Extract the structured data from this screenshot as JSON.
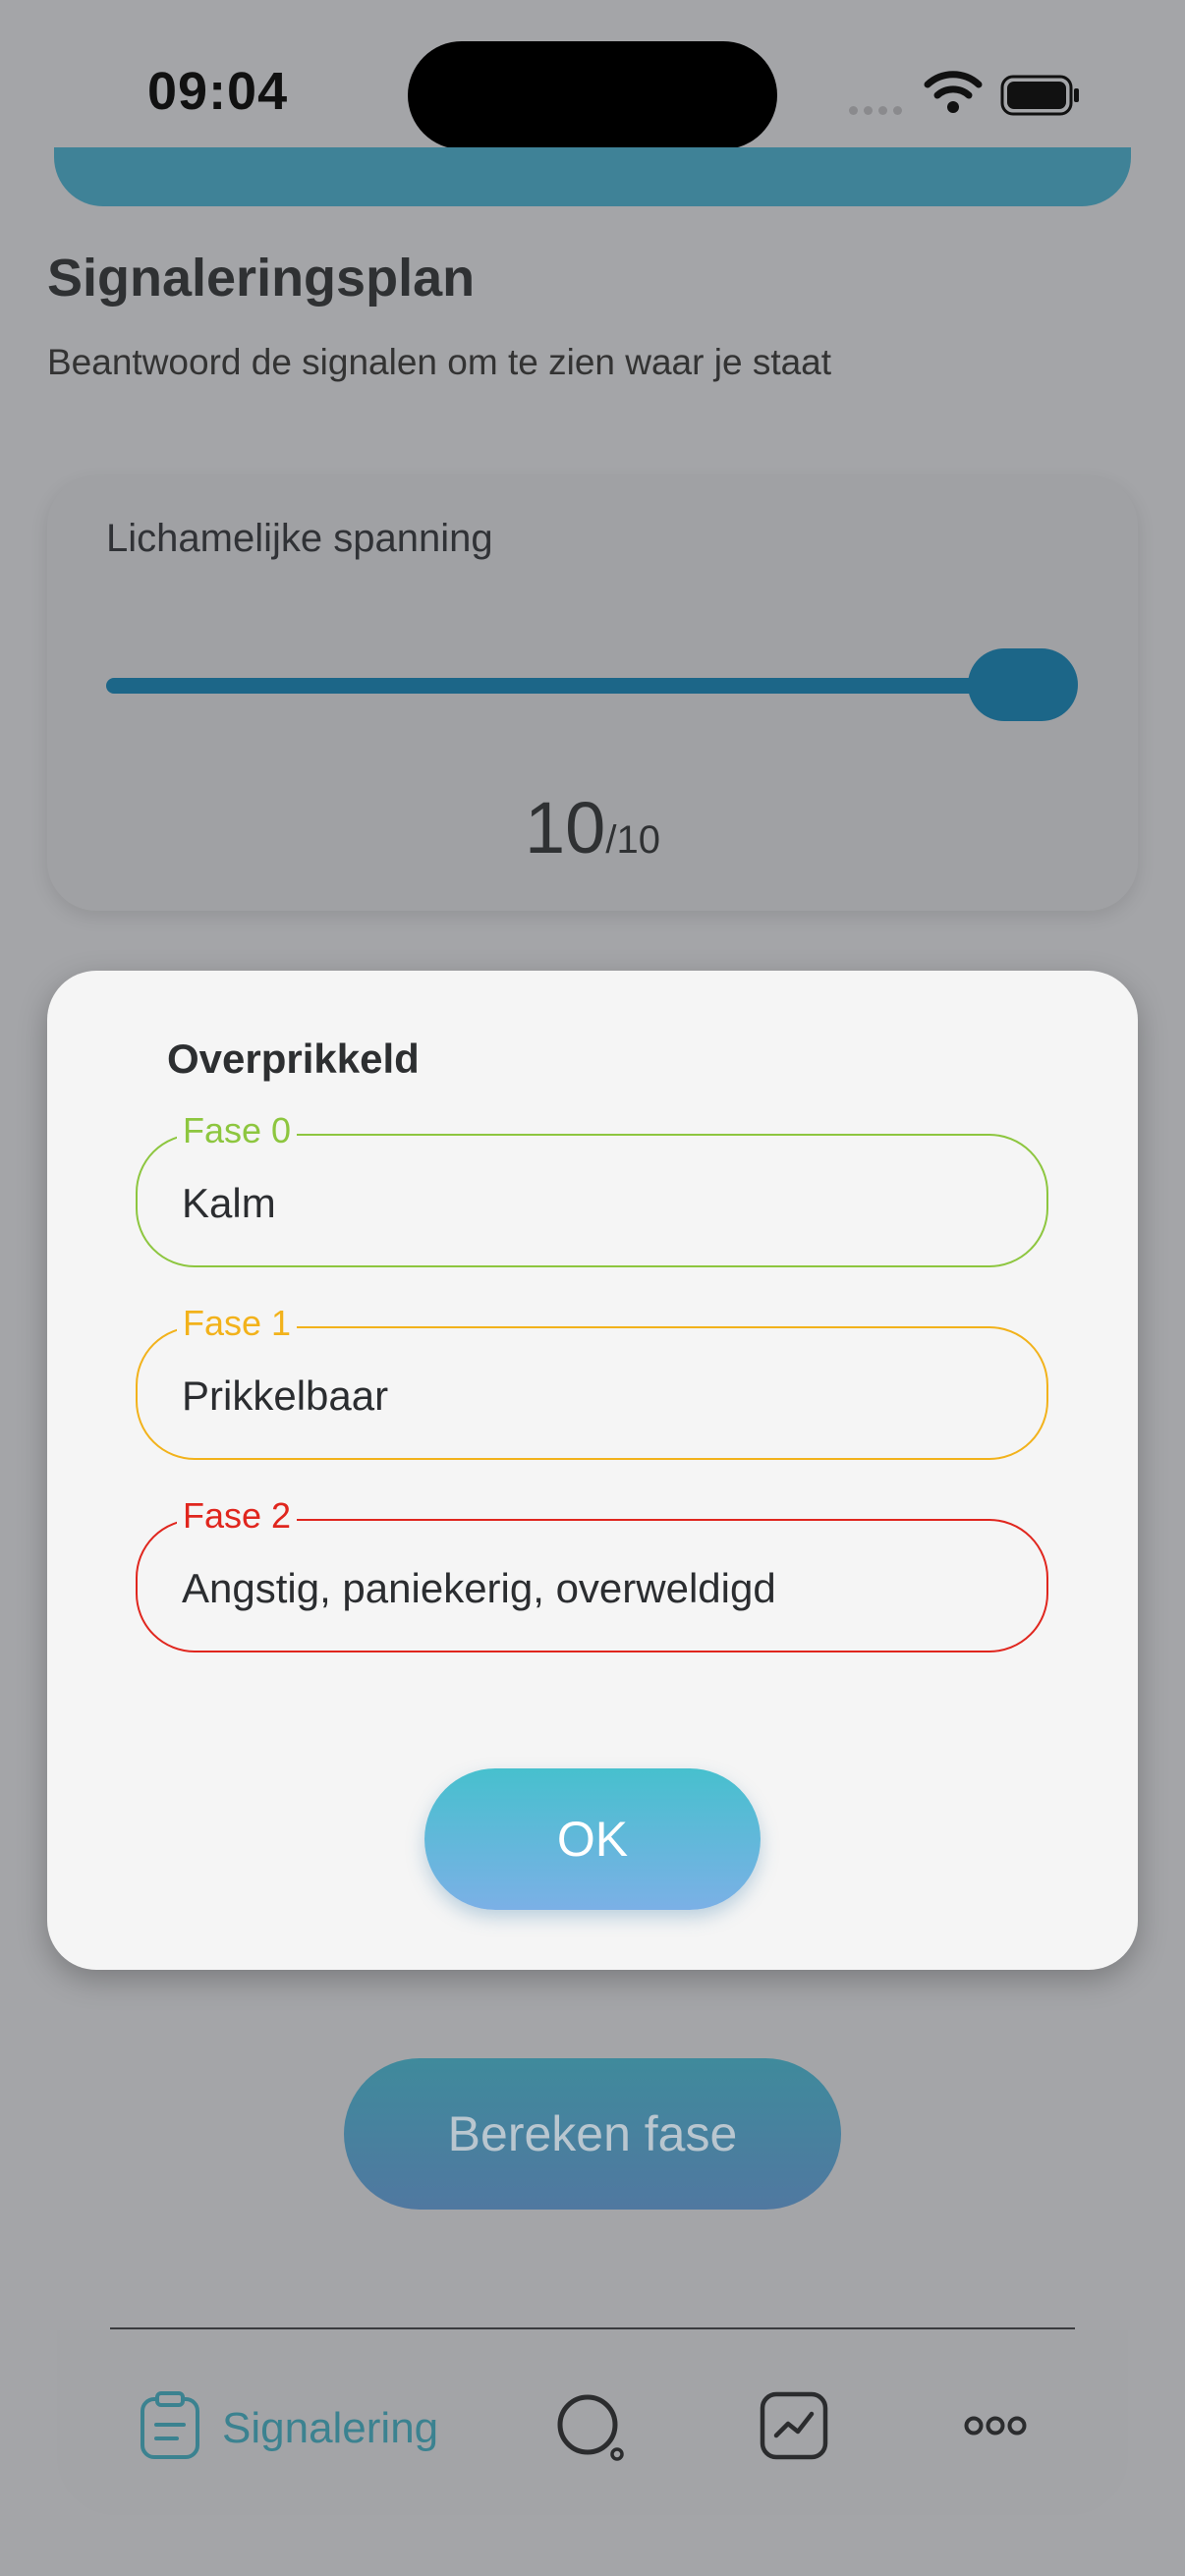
{
  "status_bar": {
    "time": "09:04"
  },
  "page": {
    "title": "Signaleringsplan",
    "subtitle": "Beantwoord de signalen om te zien waar je staat"
  },
  "signal_card": {
    "title": "Lichamelijke spanning",
    "value": "10",
    "max": "/10",
    "slider_level": 1.0
  },
  "dialog": {
    "title": "Overprikkeld",
    "phases": [
      {
        "label": "Fase 0",
        "text": "Kalm",
        "color": "#8dc63f"
      },
      {
        "label": "Fase 1",
        "text": "Prikkelbaar",
        "color": "#f2b21b"
      },
      {
        "label": "Fase 2",
        "text": "Angstig, paniekerig, overweldigd",
        "color": "#e0261e"
      }
    ],
    "ok_label": "OK"
  },
  "calculate_button": "Bereken fase",
  "navbar": {
    "active_label": "Signalering",
    "icons": [
      "clipboard-icon",
      "search-icon",
      "chart-icon",
      "more-icon"
    ]
  },
  "colors": {
    "accent": "#1c6688",
    "nav_active": "#3b8290",
    "ok_gradient_top": "#47c0ce",
    "ok_gradient_bottom": "#7bb0e6"
  }
}
